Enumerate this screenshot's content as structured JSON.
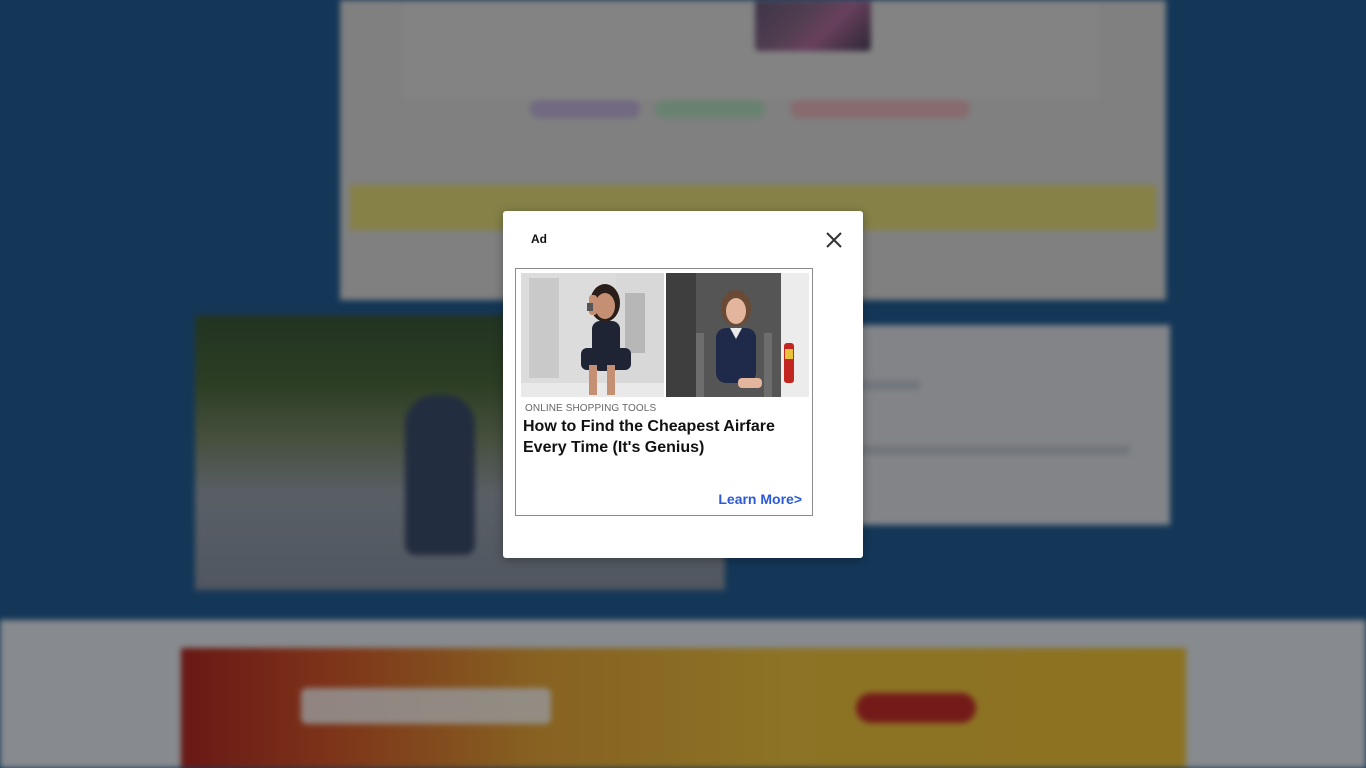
{
  "ad_modal": {
    "label": "Ad",
    "close_icon": "close-icon",
    "category": "ONLINE SHOPPING TOOLS",
    "headline": "How to Find the Cheapest Airfare Every Time (It's Genius)",
    "cta": "Learn More>",
    "images": [
      "flight-attendant-on-phone-photo",
      "flight-attendant-seated-photo"
    ],
    "cta_color": "#2a5ad7"
  },
  "background": {
    "page_color": "#245f98",
    "banner_colors": [
      "#b52a25",
      "#f3c53a"
    ]
  }
}
